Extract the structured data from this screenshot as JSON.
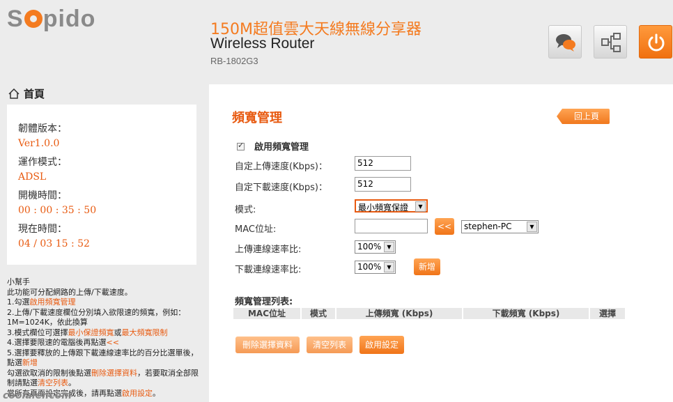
{
  "header": {
    "logo": "Sapido",
    "title_cn": "150M超值雲大天線無線分享器",
    "title_en": "Wireless Router",
    "model": "RB-1802G3",
    "buttons": {
      "chat_icon": "chat-bubbles-icon",
      "network_icon": "network-topology-icon",
      "power_icon": "power-icon"
    }
  },
  "sidebar": {
    "home_label": "首頁",
    "info": {
      "firmware_label": "韌體版本：",
      "firmware_value": "Ver1.0.0",
      "mode_label": "運作模式：",
      "mode_value": "ADSL",
      "uptime_label": "開機時間：",
      "uptime_value": "00 : 00 : 35 : 50",
      "time_label": "現在時間：",
      "time_value": "04 / 03  15 : 52"
    },
    "helper": {
      "title": "小幫手",
      "l1": "此功能可分配網路的上傳/下載速度。",
      "l2a": "1.勾選",
      "l2b": "啟用頻寬管理",
      "l3": "2.上傳/下載速度欄位分別填入欲限速的頻寬，例如：1M=1024K，依此換算",
      "l4a": "3.模式欄位可選擇",
      "l4b": "最小保證頻寬",
      "l4c": "或",
      "l4d": "最大頻寬限制",
      "l5a": "4.選擇要限速的電腦後再點選",
      "l5b": "<<",
      "l6a": "5.選擇要釋放的上傳跟下載連線速率比的百分比選單後，點選",
      "l6b": "新增",
      "l7a": "勾選欲取消的限制後點選",
      "l7b": "刪除選擇資料",
      "l7c": "，若要取消全部限制請點選",
      "l7d": "清空列表",
      "l7e": "。",
      "l8a": "當所有頁面設定完成後，請再點選",
      "l8b": "啟用設定",
      "l8c": "。"
    }
  },
  "main": {
    "title": "頻寬管理",
    "back_label": "回上頁",
    "enable_label": "啟用頻寬管理",
    "enabled": true,
    "upload_label": "自定上傳速度(Kbps)：",
    "upload_value": "512",
    "download_label": "自定下載速度(Kbps)：",
    "download_value": "512",
    "mode_label": "模式:",
    "mode_value": "最小頻寬保證",
    "mac_label": "MAC位址:",
    "mac_value": "",
    "mac_arrow_label": "<<",
    "pc_value": "stephen-PC",
    "up_ratio_label": "上傳連線速率比:",
    "up_ratio_value": "100%",
    "down_ratio_label": "下載連線速率比:",
    "down_ratio_value": "100%",
    "add_label": "新增",
    "list_title": "頻寬管理列表:",
    "columns": [
      "MAC位址",
      "模式",
      "上傳頻寬 (Kbps)",
      "下載頻寬 (Kbps)",
      "選擇"
    ],
    "delete_label": "刪除選擇資料",
    "clear_label": "清空列表",
    "apply_label": "啟用設定"
  },
  "watermark": "coolaler.com"
}
